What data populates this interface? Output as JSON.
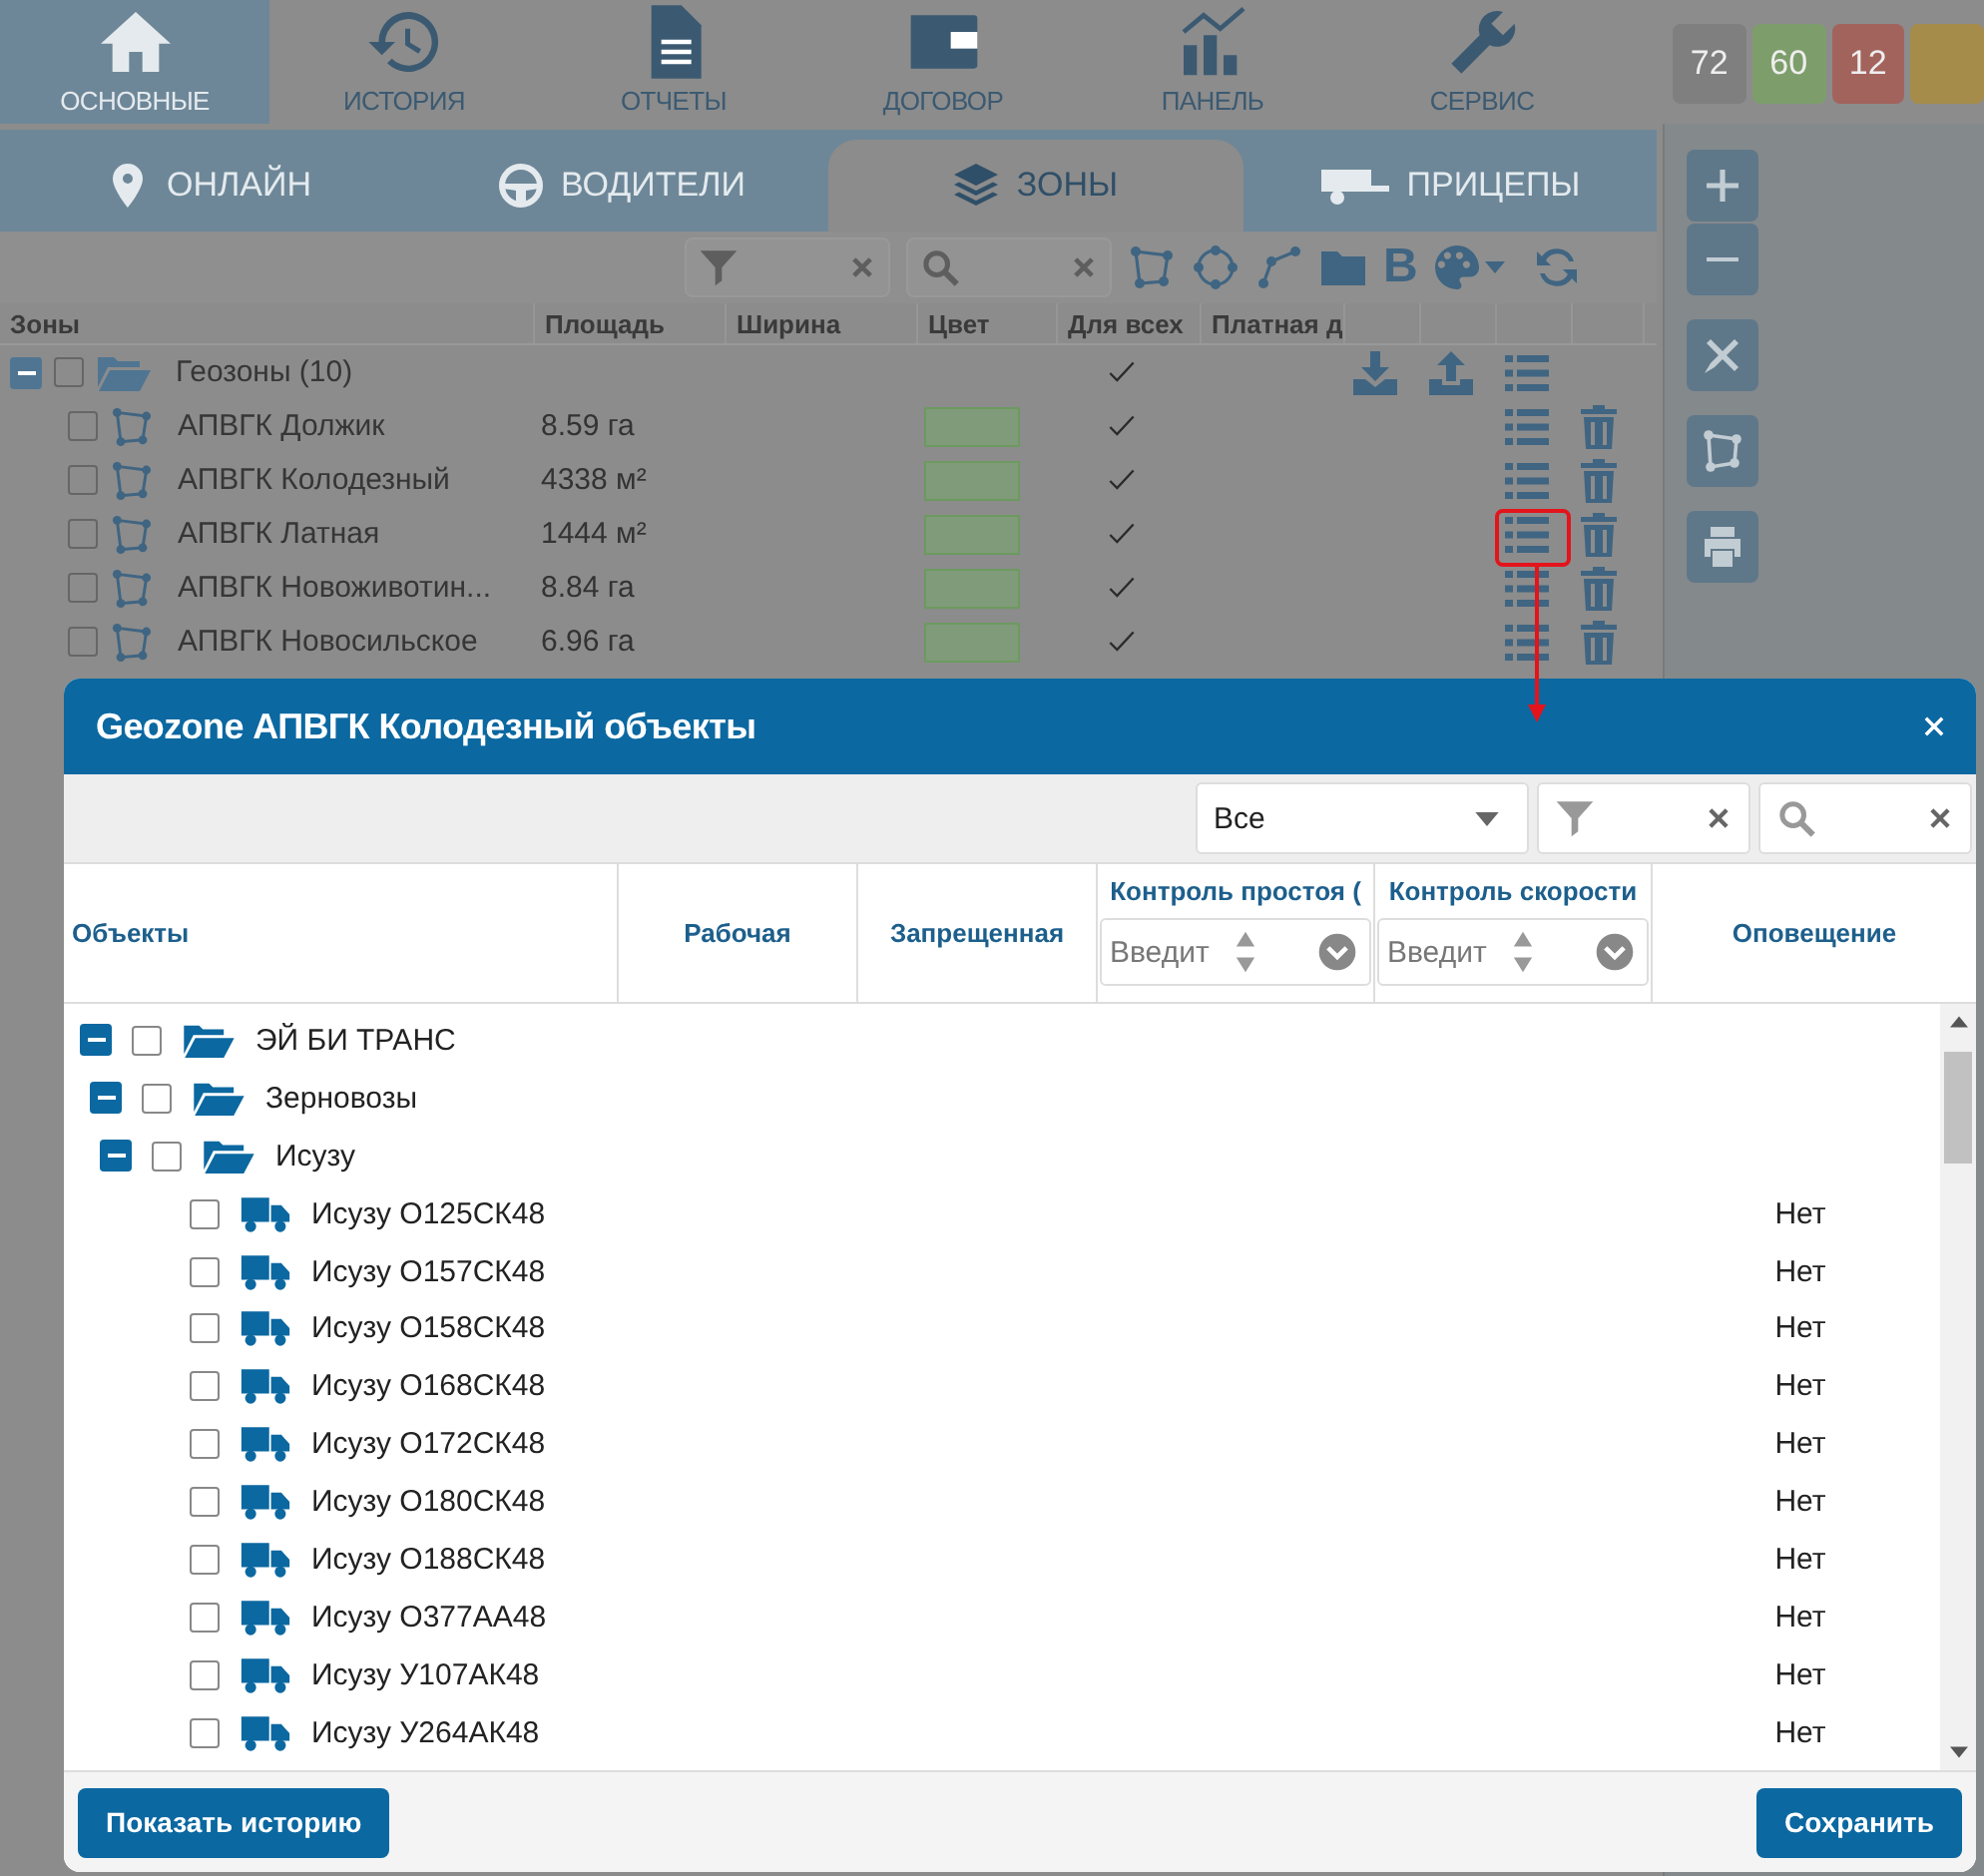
{
  "top_nav": [
    {
      "label": "ОСНОВНЫЕ",
      "selected": true
    },
    {
      "label": "ИСТОРИЯ",
      "selected": false
    },
    {
      "label": "ОТЧЕТЫ",
      "selected": false
    },
    {
      "label": "ДОГОВОР",
      "selected": false
    },
    {
      "label": "ПАНЕЛЬ",
      "selected": false
    },
    {
      "label": "СЕРВИС",
      "selected": false
    }
  ],
  "counters": [
    {
      "value": "72",
      "color": "#7f7f7f"
    },
    {
      "value": "60",
      "color": "#7d9e6b"
    },
    {
      "value": "12",
      "color": "#a3635d"
    },
    {
      "color": "#a68c4a"
    }
  ],
  "sub_tabs": [
    {
      "label": "ОНЛАЙН",
      "selected": false
    },
    {
      "label": "ВОДИТЕЛИ",
      "selected": false
    },
    {
      "label": "ЗОНЫ",
      "selected": true
    },
    {
      "label": "ПРИЦЕПЫ",
      "selected": false
    }
  ],
  "zones_toolbar": {
    "bold_tool": "B"
  },
  "zones_table": {
    "columns": [
      "Зоны",
      "Площадь",
      "Ширина",
      "Цвет",
      "Для всех",
      "Платная д"
    ],
    "group": {
      "label": "Геозоны (10)",
      "expanded": true,
      "checked": false,
      "for_all": true,
      "children": [
        {
          "name": "АПВГК Должик",
          "area": "8.59 га",
          "for_all": true,
          "checked": false,
          "highlighted": false
        },
        {
          "name": "АПВГК Колодезный",
          "area": "4338 м²",
          "for_all": true,
          "checked": false,
          "highlighted": false
        },
        {
          "name": "АПВГК Латная",
          "area": "1444 м²",
          "for_all": true,
          "checked": false,
          "highlighted": true
        },
        {
          "name": "АПВГК Новоживотин...",
          "area": "8.84 га",
          "for_all": true,
          "checked": false,
          "highlighted": false
        },
        {
          "name": "АПВГК Новосильское",
          "area": "6.96 га",
          "for_all": true,
          "checked": false,
          "highlighted": false
        }
      ]
    }
  },
  "dialog": {
    "title": "Geozone АПВГК Колодезный объекты",
    "filter_select": {
      "value": "Все"
    },
    "columns": [
      {
        "label": "Объекты"
      },
      {
        "label": "Рабочая"
      },
      {
        "label": "Запрещенная"
      },
      {
        "label": "Контроль простоя (",
        "placeholder": "Введит"
      },
      {
        "label": "Контроль скорости",
        "placeholder": "Введит"
      },
      {
        "label": "Оповещение"
      }
    ],
    "tree": [
      {
        "label": "ЭЙ БИ ТРАНС",
        "kind": "folder",
        "expanded": true,
        "checked": false,
        "children": [
          {
            "label": "Зерновозы",
            "kind": "folder",
            "expanded": true,
            "checked": false,
            "children": [
              {
                "label": "Исузу",
                "kind": "folder",
                "expanded": true,
                "checked": false,
                "children": [
                  {
                    "label": "Исузу О125СК48",
                    "kind": "vehicle",
                    "checked": false,
                    "alert": "Нет"
                  },
                  {
                    "label": "Исузу О157СК48",
                    "kind": "vehicle",
                    "checked": false,
                    "alert": "Нет"
                  },
                  {
                    "label": "Исузу О158СК48",
                    "kind": "vehicle",
                    "checked": false,
                    "alert": "Нет"
                  },
                  {
                    "label": "Исузу О168СК48",
                    "kind": "vehicle",
                    "checked": false,
                    "alert": "Нет"
                  },
                  {
                    "label": "Исузу О172СК48",
                    "kind": "vehicle",
                    "checked": false,
                    "alert": "Нет"
                  },
                  {
                    "label": "Исузу О180СК48",
                    "kind": "vehicle",
                    "checked": false,
                    "alert": "Нет"
                  },
                  {
                    "label": "Исузу О188СК48",
                    "kind": "vehicle",
                    "checked": false,
                    "alert": "Нет"
                  },
                  {
                    "label": "Исузу О377АА48",
                    "kind": "vehicle",
                    "checked": false,
                    "alert": "Нет"
                  },
                  {
                    "label": "Исузу У107АК48",
                    "kind": "vehicle",
                    "checked": false,
                    "alert": "Нет"
                  },
                  {
                    "label": "Исузу У264АК48",
                    "kind": "vehicle",
                    "checked": false,
                    "alert": "Нет"
                  }
                ]
              }
            ]
          }
        ]
      }
    ],
    "buttons": {
      "history": "Показать историю",
      "save": "Сохранить"
    }
  }
}
